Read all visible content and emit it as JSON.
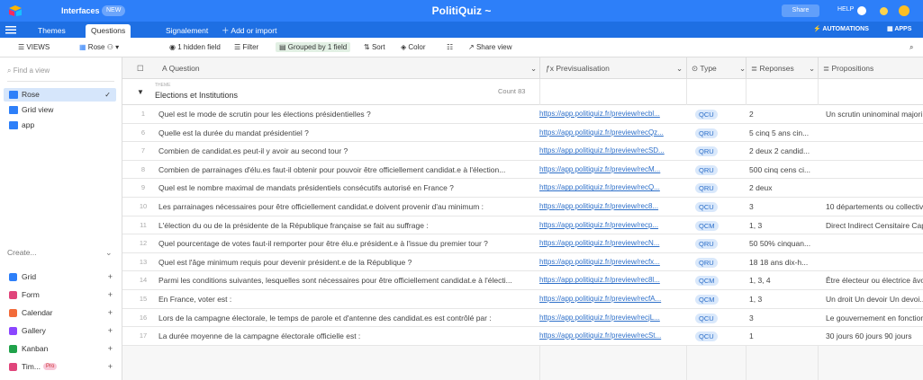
{
  "topbar": {
    "workspace": "Interfaces",
    "pill": "NEW",
    "title": "PolitiQuiz ~",
    "share": "Share",
    "help": "HELP"
  },
  "tabs": {
    "items": [
      "Themes",
      "Questions",
      "Signalement"
    ],
    "add_import": "Add or import",
    "automations": "AUTOMATIONS",
    "apps": "APPS"
  },
  "viewbar": {
    "views": "VIEWS",
    "current_view": "Rose",
    "hidden": "1 hidden field",
    "filter": "Filter",
    "grouped": "Grouped by 1 field",
    "sort": "Sort",
    "color": "Color",
    "share": "Share view"
  },
  "sidebar": {
    "find_placeholder": "Find a view",
    "views": [
      "Rose",
      "Grid view",
      "app"
    ],
    "create_label": "Create...",
    "create_items": [
      {
        "label": "Grid",
        "color": "#2d7ff9"
      },
      {
        "label": "Form",
        "color": "#e0457b"
      },
      {
        "label": "Calendar",
        "color": "#f26b3a"
      },
      {
        "label": "Gallery",
        "color": "#8b46ff"
      },
      {
        "label": "Kanban",
        "color": "#20a24a"
      },
      {
        "label": "Tim...",
        "color": "#e0457b",
        "badge": "Pro"
      }
    ]
  },
  "grid": {
    "columns": {
      "question": "Question",
      "preview": "Previsualisation",
      "type": "Type",
      "reponses": "Reponses",
      "propositions": "Propositions"
    },
    "group_sub": "THEME",
    "group_name": "Elections et Institutions",
    "group_count": "Count 83",
    "rows": [
      {
        "num": "1",
        "q": "Quel est le mode de scrutin pour les élections présidentielles ?",
        "url": "https://app.politiquiz.fr/preview/recbl...",
        "type": "QCU",
        "rep": "2",
        "prop": "Un scrutin uninominal majori..."
      },
      {
        "num": "6",
        "q": "Quelle est la durée du mandat présidentiel ?",
        "url": "https://app.politiquiz.fr/preview/recQz...",
        "type": "QRU",
        "rep": "5 cinq 5 ans cin...",
        "prop": ""
      },
      {
        "num": "7",
        "q": "Combien de candidat.es peut-il y avoir au second tour ?",
        "url": "https://app.politiquiz.fr/preview/recSD...",
        "type": "QRU",
        "rep": "2 deux 2 candid...",
        "prop": ""
      },
      {
        "num": "8",
        "q": "Combien de parrainages d'élu.es faut-il obtenir pour pouvoir être officiellement candidat.e à l'élection...",
        "url": "https://app.politiquiz.fr/preview/recM...",
        "type": "QRU",
        "rep": "500 cinq cens ci...",
        "prop": ""
      },
      {
        "num": "9",
        "q": "Quel est le nombre maximal de mandats présidentiels consécutifs autorisé en France ?",
        "url": "https://app.politiquiz.fr/preview/recQ...",
        "type": "QRU",
        "rep": "2 deux",
        "prop": ""
      },
      {
        "num": "10",
        "q": "Les parrainages nécessaires pour être officiellement candidat.e doivent provenir d'au minimum :",
        "url": "https://app.politiquiz.fr/preview/rec8...",
        "type": "QCU",
        "rep": "3",
        "prop": "10 départements ou collectiv..."
      },
      {
        "num": "11",
        "q": "L'élection du ou de la présidente de la République française se fait au suffrage :",
        "url": "https://app.politiquiz.fr/preview/recp...",
        "type": "QCM",
        "rep": "1, 3",
        "prop": "Direct Indirect Censitaire Cap..."
      },
      {
        "num": "12",
        "q": "Quel pourcentage de votes faut-il remporter pour être élu.e président.e à l'issue du premier tour ?",
        "url": "https://app.politiquiz.fr/preview/recN...",
        "type": "QRU",
        "rep": "50 50% cinquan...",
        "prop": ""
      },
      {
        "num": "13",
        "q": "Quel est l'âge minimum requis pour devenir président.e de la République ?",
        "url": "https://app.politiquiz.fr/preview/recfx...",
        "type": "QRU",
        "rep": "18 18 ans dix-h...",
        "prop": ""
      },
      {
        "num": "14",
        "q": "Parmi les conditions suivantes, lesquelles sont nécessaires pour être officiellement candidat.e à l'électi...",
        "url": "https://app.politiquiz.fr/preview/rec8l...",
        "type": "QCM",
        "rep": "1, 3, 4",
        "prop": "Être électeur ou électrice âvo..."
      },
      {
        "num": "15",
        "q": "En France, voter est :",
        "url": "https://app.politiquiz.fr/preview/recfA...",
        "type": "QCM",
        "rep": "1, 3",
        "prop": "Un droit Un devoir Un devoi..."
      },
      {
        "num": "16",
        "q": "Lors de la campagne électorale, le temps de parole et d'antenne des candidat.es est contrôlé par :",
        "url": "https://app.politiquiz.fr/preview/recjL...",
        "type": "QCU",
        "rep": "3",
        "prop": "Le gouvernement en fonction..."
      },
      {
        "num": "17",
        "q": "La durée moyenne de la campagne électorale officielle est :",
        "url": "https://app.politiquiz.fr/preview/recSt...",
        "type": "QCU",
        "rep": "1",
        "prop": "30 jours 60 jours 90 jours"
      }
    ]
  }
}
